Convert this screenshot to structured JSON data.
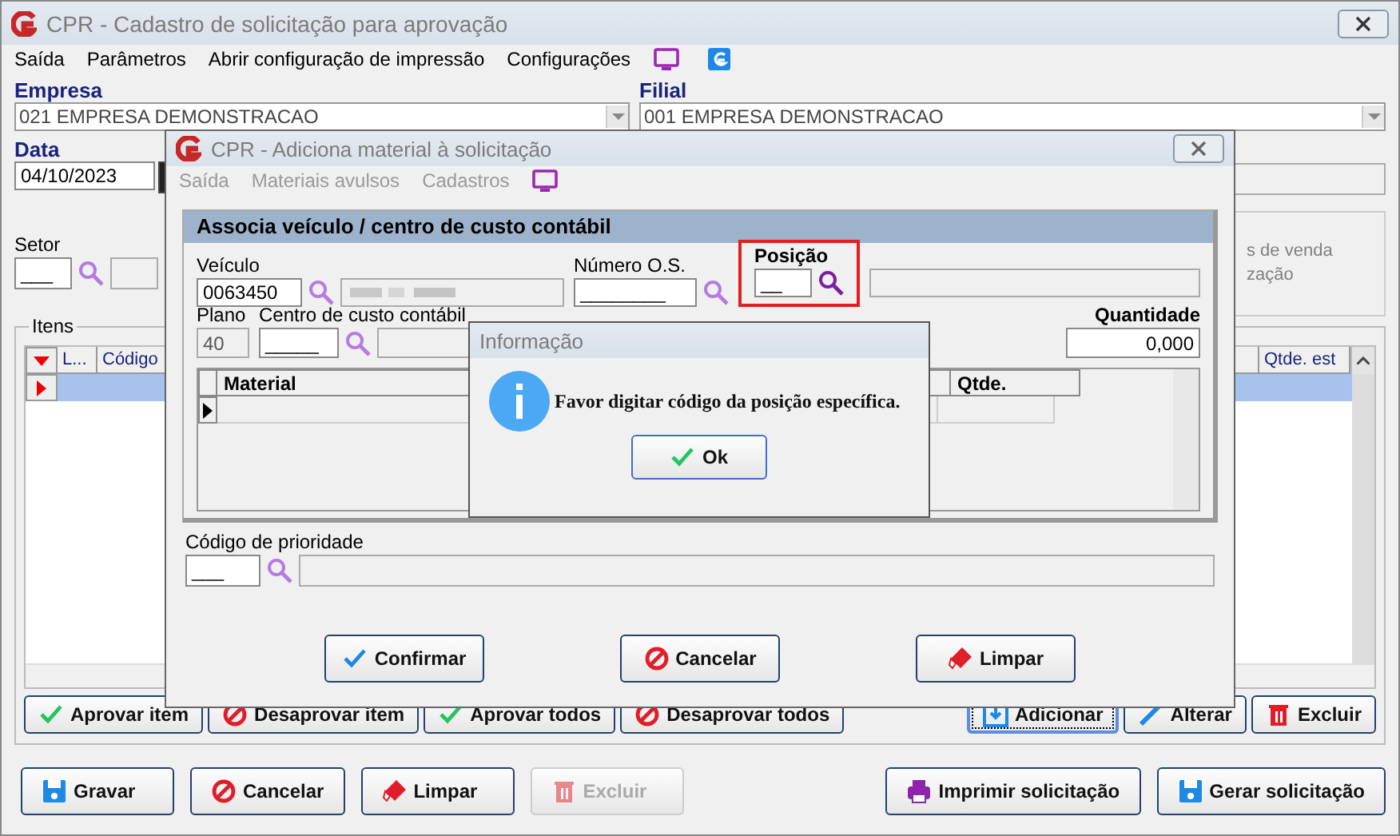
{
  "main_window": {
    "title": "CPR - Cadastro de solicitação para aprovação",
    "menu": [
      "Saída",
      "Parâmetros",
      "Abrir configuração de impressão",
      "Configurações"
    ],
    "empresa": {
      "label": "Empresa",
      "value": "021 EMPRESA DEMONSTRACAO"
    },
    "filial": {
      "label": "Filial",
      "value": "001 EMPRESA DEMONSTRACAO"
    },
    "data": {
      "label": "Data",
      "value": "04/10/2023"
    },
    "setor": {
      "label": "Setor",
      "value": "___"
    },
    "side_group_lines": [
      "s de venda",
      "zação"
    ],
    "itens": {
      "label": "Itens",
      "columns": [
        "L...",
        "Código",
        "Qtde. est"
      ]
    },
    "item_buttons": [
      {
        "label": "Aprovar item",
        "focused": false
      },
      {
        "label": "Desaprovar item",
        "focused": false
      },
      {
        "label": "Aprovar todos",
        "focused": false
      },
      {
        "label": "Desaprovar todos",
        "focused": false
      },
      {
        "label": "Adicionar",
        "focused": true
      },
      {
        "label": "Alterar",
        "focused": false
      },
      {
        "label": "Excluir",
        "focused": false
      }
    ],
    "footer_buttons": [
      {
        "label": "Gravar",
        "disabled": false
      },
      {
        "label": "Cancelar",
        "disabled": false
      },
      {
        "label": "Limpar",
        "disabled": false
      },
      {
        "label": "Excluir",
        "disabled": true
      },
      {
        "label": "Imprimir solicitação",
        "disabled": false
      },
      {
        "label": "Gerar solicitação",
        "disabled": false
      }
    ]
  },
  "material_dialog": {
    "title": "CPR - Adiciona material à solicitação",
    "menu": [
      "Saída",
      "Materiais avulsos",
      "Cadastros"
    ],
    "panel_title": "Associa veículo / centro de custo contábil",
    "veiculo": {
      "label": "Veículo",
      "value": "0063450"
    },
    "numero_os": {
      "label": "Número O.S.",
      "value": "________"
    },
    "posicao": {
      "label": "Posição",
      "value": "__",
      "highlighted": true
    },
    "plano": {
      "label": "Plano",
      "value": "40"
    },
    "centro_custo": {
      "label": "Centro de custo contábil",
      "value": "_____"
    },
    "quantidade": {
      "label": "Quantidade",
      "value": "0,000"
    },
    "grid_columns": [
      "Material",
      "Qtde."
    ],
    "prioridade": {
      "label": "Código de prioridade",
      "value": "___"
    },
    "buttons": [
      {
        "label": "Confirmar"
      },
      {
        "label": "Cancelar"
      },
      {
        "label": "Limpar"
      }
    ]
  },
  "info_dialog": {
    "title": "Informação",
    "message": "Favor digitar código da posição específica.",
    "button": "Ok"
  }
}
